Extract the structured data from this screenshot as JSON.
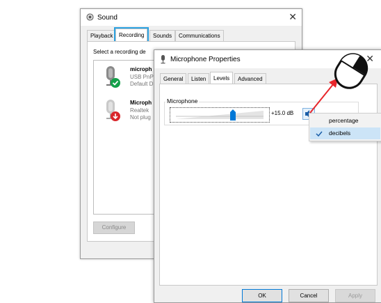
{
  "sound_window": {
    "title": "Sound",
    "tabs": [
      {
        "label": "Playback"
      },
      {
        "label": "Recording"
      },
      {
        "label": "Sounds"
      },
      {
        "label": "Communications"
      }
    ],
    "active_tab": "Recording",
    "instruction": "Select a recording de",
    "devices": [
      {
        "name": "microph",
        "line1": "USB PnP",
        "line2": "Default D",
        "status": "ok"
      },
      {
        "name": "Microph",
        "line1": "Realtek",
        "line2": "Not plug",
        "status": "unplugged"
      }
    ],
    "configure_label": "Configure"
  },
  "mic_window": {
    "title": "Microphone Properties",
    "tabs": [
      {
        "label": "General"
      },
      {
        "label": "Listen"
      },
      {
        "label": "Levels"
      },
      {
        "label": "Advanced"
      }
    ],
    "active_tab": "Levels",
    "group_label": "Microphone",
    "level_value": "+15.0 dB",
    "level_fraction": 0.65,
    "ok_label": "OK",
    "cancel_label": "Cancel",
    "apply_label": "Apply"
  },
  "context_menu": {
    "items": [
      {
        "label": "percentage",
        "checked": false
      },
      {
        "label": "decibels",
        "checked": true
      }
    ]
  },
  "colors": {
    "tab_highlight": "#2aa1e0",
    "accent": "#0078d7",
    "arrow": "#e8262b",
    "ok_green": "#14a04a",
    "unplugged_red": "#d9262b"
  },
  "overlay": {
    "mouse_icon": "right-click-mouse-icon",
    "arrow_icon": "red-arrow-icon"
  }
}
